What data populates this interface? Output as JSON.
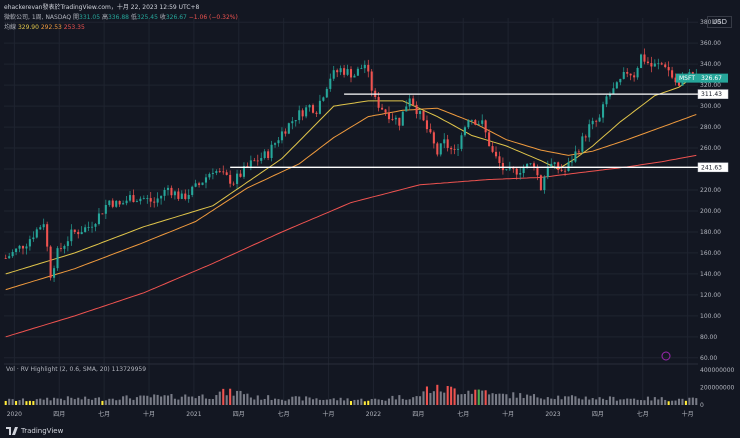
{
  "header": {
    "line1": "ehackerevan發表於TradingView.com，十月 22, 2023 12:59 UTC+8",
    "line2_prefix": "微軟公司, 1周, NASDAQ",
    "ohlc": {
      "o_label": "開",
      "o": "331.05",
      "h_label": "高",
      "h": "336.88",
      "l_label": "低",
      "l": "325.45",
      "c_label": "收",
      "c": "326.67",
      "change": "−1.06 (−0.32%)"
    },
    "ma_label": "均線",
    "ma_values": [
      "329.90",
      "292.53",
      "253.35"
    ],
    "currency": "USD"
  },
  "volume_legend": "Vol · RV Highlight (2, 0.6, SMA, 20)  113729959",
  "footer_brand": "TradingView",
  "colors": {
    "background": "#131722",
    "grid": "#1f2430",
    "up": "#26a69a",
    "down": "#ef5350",
    "ma20": "#e0c54b",
    "ma50": "#ef9a3e",
    "ma200": "#ef5350",
    "vol_default": "#787b86",
    "vol_high_up": "#4caf50",
    "vol_high_down": "#ef5350",
    "vol_low": "#ffeb3b"
  },
  "chart_data": {
    "type": "candlestick",
    "symbol": "MSFT",
    "interval": "1周",
    "price_axis": {
      "ticks": [
        60,
        80,
        100,
        120,
        140,
        160,
        180,
        200,
        220,
        240,
        260,
        280,
        300,
        320,
        340,
        360,
        380
      ],
      "ylim": [
        56,
        384
      ]
    },
    "volume_axis": {
      "ticks": [
        0,
        200000000,
        400000000
      ],
      "labels": [
        "0",
        "200000000",
        "400000000"
      ],
      "ylim": [
        0,
        400000000
      ]
    },
    "x_labels": [
      {
        "t": 2.5,
        "label": "2020"
      },
      {
        "t": 15.5,
        "label": "四月"
      },
      {
        "t": 28.5,
        "label": "七月"
      },
      {
        "t": 41.5,
        "label": "十月"
      },
      {
        "t": 54.5,
        "label": "2021"
      },
      {
        "t": 67.5,
        "label": "四月"
      },
      {
        "t": 80.5,
        "label": "七月"
      },
      {
        "t": 93.5,
        "label": "十月"
      },
      {
        "t": 106.5,
        "label": "2022"
      },
      {
        "t": 119.5,
        "label": "四月"
      },
      {
        "t": 132.5,
        "label": "七月"
      },
      {
        "t": 145.5,
        "label": "十月"
      },
      {
        "t": 158.5,
        "label": "2023"
      },
      {
        "t": 171.5,
        "label": "四月"
      },
      {
        "t": 184.5,
        "label": "七月"
      },
      {
        "t": 197.5,
        "label": "十月"
      }
    ],
    "horizontal_lines": [
      {
        "price": 311.43,
        "label": "311.43",
        "t_start": 98
      },
      {
        "price": 241.63,
        "label": "241.63",
        "t_start": 65
      }
    ],
    "last_price_label": {
      "symbol": "MSFT",
      "value": "326.67",
      "price": 326.67
    },
    "close_anchors": [
      [
        0,
        155
      ],
      [
        6,
        170
      ],
      [
        11,
        190
      ],
      [
        13,
        140
      ],
      [
        15,
        160
      ],
      [
        19,
        178
      ],
      [
        24,
        185
      ],
      [
        27,
        196
      ],
      [
        30,
        210
      ],
      [
        33,
        205
      ],
      [
        36,
        213
      ],
      [
        40,
        212
      ],
      [
        43,
        208
      ],
      [
        47,
        222
      ],
      [
        51,
        212
      ],
      [
        56,
        225
      ],
      [
        60,
        240
      ],
      [
        63,
        233
      ],
      [
        66,
        228
      ],
      [
        71,
        245
      ],
      [
        76,
        255
      ],
      [
        80,
        275
      ],
      [
        84,
        290
      ],
      [
        88,
        300
      ],
      [
        90,
        297
      ],
      [
        94,
        328
      ],
      [
        97,
        335
      ],
      [
        101,
        330
      ],
      [
        104,
        340
      ],
      [
        107,
        305
      ],
      [
        110,
        295
      ],
      [
        114,
        285
      ],
      [
        117,
        310
      ],
      [
        122,
        278
      ],
      [
        125,
        255
      ],
      [
        127,
        265
      ],
      [
        130,
        255
      ],
      [
        134,
        290
      ],
      [
        138,
        283
      ],
      [
        141,
        255
      ],
      [
        145,
        235
      ],
      [
        149,
        240
      ],
      [
        153,
        245
      ],
      [
        155,
        222
      ],
      [
        157,
        245
      ],
      [
        160,
        240
      ],
      [
        162,
        238
      ],
      [
        165,
        255
      ],
      [
        169,
        280
      ],
      [
        172,
        287
      ],
      [
        174,
        308
      ],
      [
        177,
        318
      ],
      [
        180,
        333
      ],
      [
        182,
        330
      ],
      [
        184,
        348
      ],
      [
        187,
        338
      ],
      [
        191,
        340
      ],
      [
        193,
        328
      ],
      [
        195,
        318
      ],
      [
        197,
        333
      ],
      [
        199,
        327
      ],
      [
        200,
        326.67
      ]
    ],
    "ma_anchors": {
      "ma20": [
        [
          0,
          140
        ],
        [
          20,
          160
        ],
        [
          40,
          185
        ],
        [
          60,
          205
        ],
        [
          80,
          250
        ],
        [
          95,
          300
        ],
        [
          105,
          305
        ],
        [
          115,
          305
        ],
        [
          125,
          290
        ],
        [
          135,
          272
        ],
        [
          145,
          262
        ],
        [
          155,
          248
        ],
        [
          160,
          240
        ],
        [
          165,
          250
        ],
        [
          170,
          262
        ],
        [
          178,
          285
        ],
        [
          188,
          310
        ],
        [
          195,
          318
        ],
        [
          200,
          330
        ]
      ],
      "ma50": [
        [
          0,
          125
        ],
        [
          20,
          145
        ],
        [
          40,
          170
        ],
        [
          55,
          190
        ],
        [
          70,
          222
        ],
        [
          85,
          245
        ],
        [
          95,
          270
        ],
        [
          105,
          290
        ],
        [
          115,
          296
        ],
        [
          125,
          298
        ],
        [
          135,
          285
        ],
        [
          145,
          268
        ],
        [
          155,
          258
        ],
        [
          163,
          253
        ],
        [
          170,
          257
        ],
        [
          180,
          268
        ],
        [
          190,
          280
        ],
        [
          200,
          292
        ]
      ],
      "ma200": [
        [
          0,
          80
        ],
        [
          20,
          100
        ],
        [
          40,
          122
        ],
        [
          60,
          150
        ],
        [
          80,
          180
        ],
        [
          100,
          208
        ],
        [
          120,
          225
        ],
        [
          140,
          230
        ],
        [
          155,
          232
        ],
        [
          165,
          236
        ],
        [
          180,
          242
        ],
        [
          190,
          247
        ],
        [
          200,
          253
        ]
      ]
    },
    "volume_levels": [
      0.3,
      0.4,
      0.38,
      0.45,
      0.5,
      0.55,
      0.75,
      0.45,
      0.4,
      0.35,
      0.32,
      0.48,
      0.95,
      0.88,
      0.6,
      0.52,
      0.45,
      0.4,
      0.38,
      0.35
    ]
  }
}
